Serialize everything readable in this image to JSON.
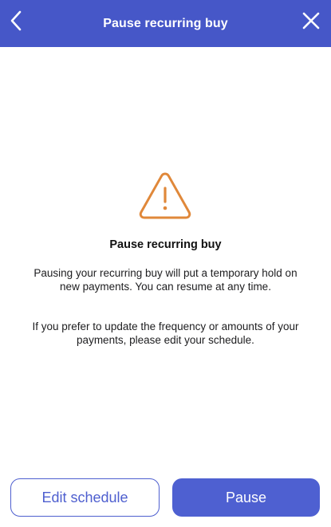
{
  "header": {
    "title": "Pause recurring buy",
    "back_icon": "chevron-left-icon",
    "close_icon": "close-icon",
    "background_color": "#4657c8"
  },
  "content": {
    "icon": "warning-triangle-icon",
    "icon_color": "#e0883a",
    "title": "Pause recurring buy",
    "paragraph_1": "Pausing your recurring buy will put a temporary hold on new payments. You can resume at any time.",
    "paragraph_2": "If you prefer to update the frequency or amounts of your payments, please edit your schedule."
  },
  "actions": {
    "edit_label": "Edit schedule",
    "pause_label": "Pause",
    "accent_color": "#4e60d1"
  }
}
